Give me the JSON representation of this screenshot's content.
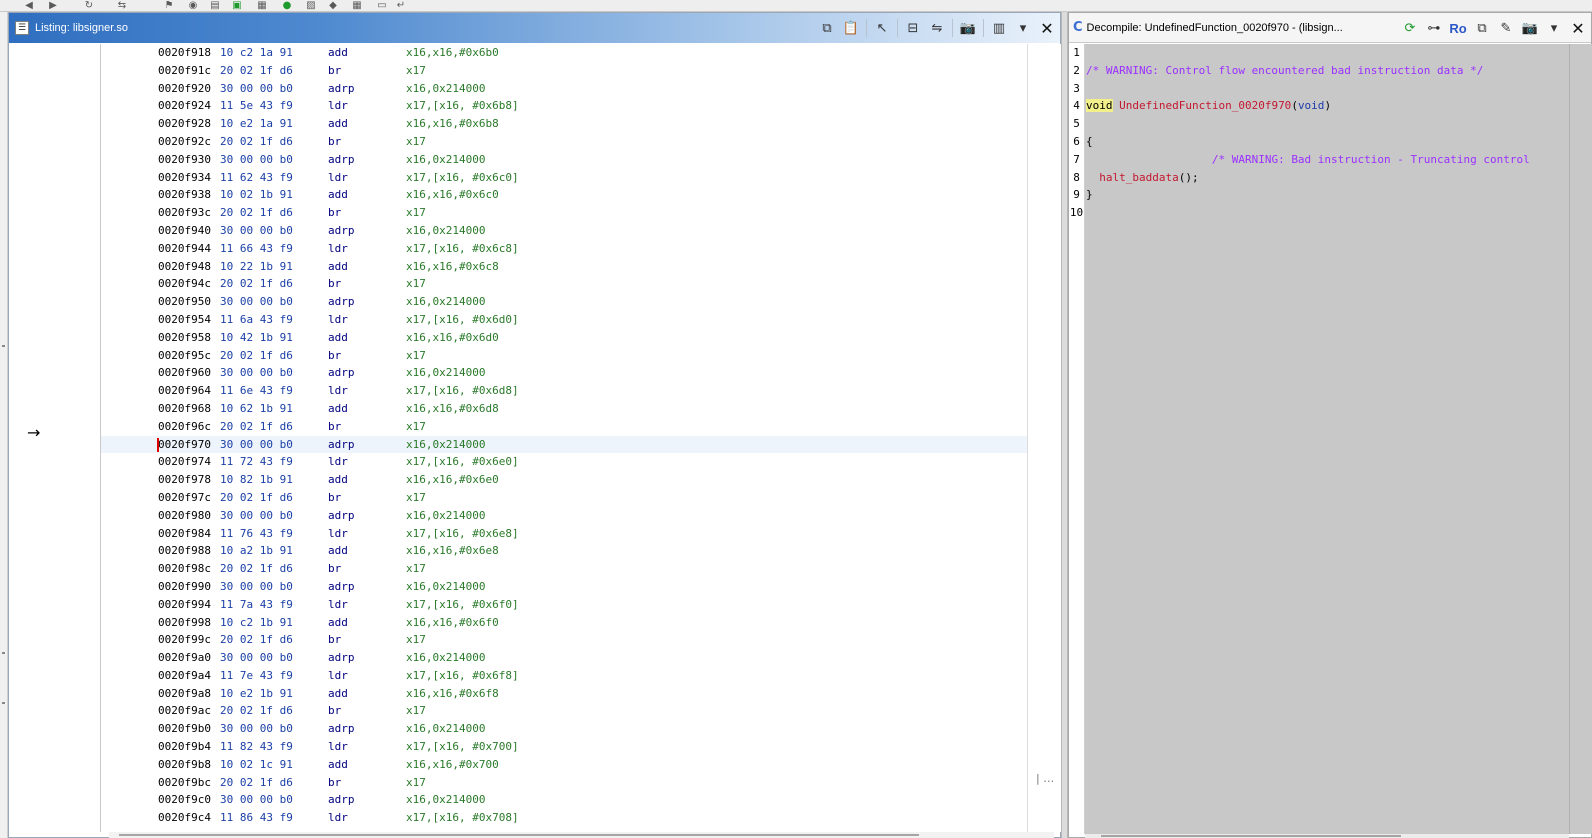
{
  "toolbar": {
    "icons": [
      "back-icon",
      "forward-icon",
      "refresh-icon",
      "nav-icon",
      "bookmark-icon",
      "analyze-icon",
      "memory-icon",
      "symbol-icon",
      "data-icon",
      "check-icon",
      "memory-map-icon",
      "shield-icon",
      "table-icon",
      "export-icon",
      "settings-icon"
    ]
  },
  "listing": {
    "title": "Listing:  libsigner.so",
    "rows": [
      {
        "addr": "0020f918",
        "bytes": "10 c2 1a 91",
        "mnem": "add",
        "ops": "x16,x16,#0x6b0"
      },
      {
        "addr": "0020f91c",
        "bytes": "20 02 1f d6",
        "mnem": "br",
        "ops": "x17"
      },
      {
        "addr": "0020f920",
        "bytes": "30 00 00 b0",
        "mnem": "adrp",
        "ops": "x16,0x214000"
      },
      {
        "addr": "0020f924",
        "bytes": "11 5e 43 f9",
        "mnem": "ldr",
        "ops": "x17,[x16, #0x6b8]"
      },
      {
        "addr": "0020f928",
        "bytes": "10 e2 1a 91",
        "mnem": "add",
        "ops": "x16,x16,#0x6b8"
      },
      {
        "addr": "0020f92c",
        "bytes": "20 02 1f d6",
        "mnem": "br",
        "ops": "x17"
      },
      {
        "addr": "0020f930",
        "bytes": "30 00 00 b0",
        "mnem": "adrp",
        "ops": "x16,0x214000"
      },
      {
        "addr": "0020f934",
        "bytes": "11 62 43 f9",
        "mnem": "ldr",
        "ops": "x17,[x16, #0x6c0]"
      },
      {
        "addr": "0020f938",
        "bytes": "10 02 1b 91",
        "mnem": "add",
        "ops": "x16,x16,#0x6c0"
      },
      {
        "addr": "0020f93c",
        "bytes": "20 02 1f d6",
        "mnem": "br",
        "ops": "x17"
      },
      {
        "addr": "0020f940",
        "bytes": "30 00 00 b0",
        "mnem": "adrp",
        "ops": "x16,0x214000"
      },
      {
        "addr": "0020f944",
        "bytes": "11 66 43 f9",
        "mnem": "ldr",
        "ops": "x17,[x16, #0x6c8]"
      },
      {
        "addr": "0020f948",
        "bytes": "10 22 1b 91",
        "mnem": "add",
        "ops": "x16,x16,#0x6c8"
      },
      {
        "addr": "0020f94c",
        "bytes": "20 02 1f d6",
        "mnem": "br",
        "ops": "x17"
      },
      {
        "addr": "0020f950",
        "bytes": "30 00 00 b0",
        "mnem": "adrp",
        "ops": "x16,0x214000"
      },
      {
        "addr": "0020f954",
        "bytes": "11 6a 43 f9",
        "mnem": "ldr",
        "ops": "x17,[x16, #0x6d0]"
      },
      {
        "addr": "0020f958",
        "bytes": "10 42 1b 91",
        "mnem": "add",
        "ops": "x16,x16,#0x6d0"
      },
      {
        "addr": "0020f95c",
        "bytes": "20 02 1f d6",
        "mnem": "br",
        "ops": "x17"
      },
      {
        "addr": "0020f960",
        "bytes": "30 00 00 b0",
        "mnem": "adrp",
        "ops": "x16,0x214000"
      },
      {
        "addr": "0020f964",
        "bytes": "11 6e 43 f9",
        "mnem": "ldr",
        "ops": "x17,[x16, #0x6d8]"
      },
      {
        "addr": "0020f968",
        "bytes": "10 62 1b 91",
        "mnem": "add",
        "ops": "x16,x16,#0x6d8"
      },
      {
        "addr": "0020f96c",
        "bytes": "20 02 1f d6",
        "mnem": "br",
        "ops": "x17"
      },
      {
        "addr": "0020f970",
        "bytes": "30 00 00 b0",
        "mnem": "adrp",
        "ops": "x16,0x214000",
        "selected": true
      },
      {
        "addr": "0020f974",
        "bytes": "11 72 43 f9",
        "mnem": "ldr",
        "ops": "x17,[x16, #0x6e0]"
      },
      {
        "addr": "0020f978",
        "bytes": "10 82 1b 91",
        "mnem": "add",
        "ops": "x16,x16,#0x6e0"
      },
      {
        "addr": "0020f97c",
        "bytes": "20 02 1f d6",
        "mnem": "br",
        "ops": "x17"
      },
      {
        "addr": "0020f980",
        "bytes": "30 00 00 b0",
        "mnem": "adrp",
        "ops": "x16,0x214000"
      },
      {
        "addr": "0020f984",
        "bytes": "11 76 43 f9",
        "mnem": "ldr",
        "ops": "x17,[x16, #0x6e8]"
      },
      {
        "addr": "0020f988",
        "bytes": "10 a2 1b 91",
        "mnem": "add",
        "ops": "x16,x16,#0x6e8"
      },
      {
        "addr": "0020f98c",
        "bytes": "20 02 1f d6",
        "mnem": "br",
        "ops": "x17"
      },
      {
        "addr": "0020f990",
        "bytes": "30 00 00 b0",
        "mnem": "adrp",
        "ops": "x16,0x214000"
      },
      {
        "addr": "0020f994",
        "bytes": "11 7a 43 f9",
        "mnem": "ldr",
        "ops": "x17,[x16, #0x6f0]"
      },
      {
        "addr": "0020f998",
        "bytes": "10 c2 1b 91",
        "mnem": "add",
        "ops": "x16,x16,#0x6f0"
      },
      {
        "addr": "0020f99c",
        "bytes": "20 02 1f d6",
        "mnem": "br",
        "ops": "x17"
      },
      {
        "addr": "0020f9a0",
        "bytes": "30 00 00 b0",
        "mnem": "adrp",
        "ops": "x16,0x214000"
      },
      {
        "addr": "0020f9a4",
        "bytes": "11 7e 43 f9",
        "mnem": "ldr",
        "ops": "x17,[x16, #0x6f8]"
      },
      {
        "addr": "0020f9a8",
        "bytes": "10 e2 1b 91",
        "mnem": "add",
        "ops": "x16,x16,#0x6f8"
      },
      {
        "addr": "0020f9ac",
        "bytes": "20 02 1f d6",
        "mnem": "br",
        "ops": "x17"
      },
      {
        "addr": "0020f9b0",
        "bytes": "30 00 00 b0",
        "mnem": "adrp",
        "ops": "x16,0x214000"
      },
      {
        "addr": "0020f9b4",
        "bytes": "11 82 43 f9",
        "mnem": "ldr",
        "ops": "x17,[x16, #0x700]"
      },
      {
        "addr": "0020f9b8",
        "bytes": "10 02 1c 91",
        "mnem": "add",
        "ops": "x16,x16,#0x700"
      },
      {
        "addr": "0020f9bc",
        "bytes": "20 02 1f d6",
        "mnem": "br",
        "ops": "x17"
      },
      {
        "addr": "0020f9c0",
        "bytes": "30 00 00 b0",
        "mnem": "adrp",
        "ops": "x16,0x214000"
      },
      {
        "addr": "0020f9c4",
        "bytes": "11 86 43 f9",
        "mnem": "ldr",
        "ops": "x17,[x16, #0x708]"
      }
    ]
  },
  "decompile": {
    "title": "Decompile: UndefinedFunction_0020f970 - (libsign...",
    "ro_label": "Ro",
    "line_numbers": [
      "1",
      "2",
      "3",
      "4",
      "5",
      "6",
      "7",
      "8",
      "9",
      "10"
    ],
    "lines": [
      {
        "text": ""
      },
      {
        "comment": "/* WARNING: Control flow encountered bad instruction data */"
      },
      {
        "text": ""
      },
      {
        "keyword": "void",
        "fn": " UndefinedFunction_0020f970",
        "paren_open": "(",
        "type": "void",
        "paren_close": ")"
      },
      {
        "text": ""
      },
      {
        "text": "{"
      },
      {
        "indent": "                   ",
        "comment": "/* WARNING: Bad instruction - Truncating control"
      },
      {
        "indent": "  ",
        "fn": "halt_baddata",
        "rest": "();"
      },
      {
        "text": "}"
      },
      {
        "text": ""
      }
    ]
  }
}
